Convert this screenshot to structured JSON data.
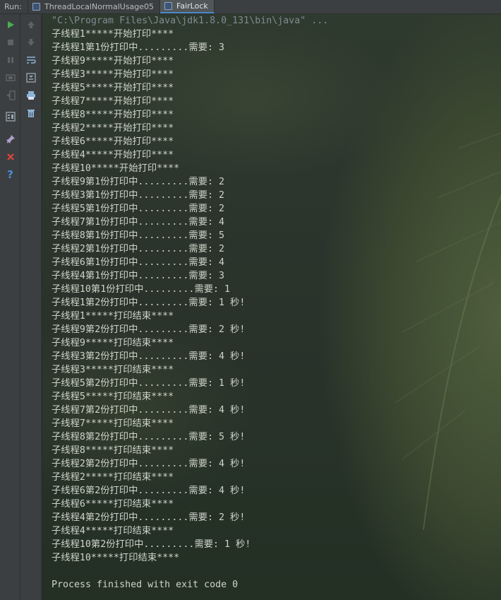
{
  "run_panel": {
    "run_label": "Run:",
    "tabs": [
      {
        "label": "ThreadLocalNormalUsage05",
        "active": false
      },
      {
        "label": "FairLock",
        "active": true
      }
    ]
  },
  "toolbar": {
    "left_icons": [
      "run-icon",
      "stop-icon",
      "pause-icon",
      "rerun-icon",
      "exit-icon",
      "layout-icon",
      "pin-icon",
      "close-icon",
      "help-icon"
    ],
    "right_icons": [
      "up-arrow-icon",
      "down-arrow-icon",
      "soft-wrap-icon",
      "scroll-to-end-icon",
      "print-icon",
      "trash-icon"
    ]
  },
  "console": {
    "command_line": "\"C:\\Program Files\\Java\\jdk1.8.0_131\\bin\\java\" ...",
    "lines": [
      "子线程1*****开始打印****",
      "子线程1第1份打印中.........需要: 3",
      "子线程9*****开始打印****",
      "子线程3*****开始打印****",
      "子线程5*****开始打印****",
      "子线程7*****开始打印****",
      "子线程8*****开始打印****",
      "子线程2*****开始打印****",
      "子线程6*****开始打印****",
      "子线程4*****开始打印****",
      "子线程10*****开始打印****",
      "子线程9第1份打印中.........需要: 2",
      "子线程3第1份打印中.........需要: 2",
      "子线程5第1份打印中.........需要: 2",
      "子线程7第1份打印中.........需要: 4",
      "子线程8第1份打印中.........需要: 5",
      "子线程2第1份打印中.........需要: 2",
      "子线程6第1份打印中.........需要: 4",
      "子线程4第1份打印中.........需要: 3",
      "子线程10第1份打印中.........需要: 1",
      "子线程1第2份打印中.........需要: 1 秒!",
      "子线程1*****打印结束****",
      "子线程9第2份打印中.........需要: 2 秒!",
      "子线程9*****打印结束****",
      "子线程3第2份打印中.........需要: 4 秒!",
      "子线程3*****打印结束****",
      "子线程5第2份打印中.........需要: 1 秒!",
      "子线程5*****打印结束****",
      "子线程7第2份打印中.........需要: 4 秒!",
      "子线程7*****打印结束****",
      "子线程8第2份打印中.........需要: 5 秒!",
      "子线程8*****打印结束****",
      "子线程2第2份打印中.........需要: 4 秒!",
      "子线程2*****打印结束****",
      "子线程6第2份打印中.........需要: 4 秒!",
      "子线程6*****打印结束****",
      "子线程4第2份打印中.........需要: 2 秒!",
      "子线程4*****打印结束****",
      "子线程10第2份打印中.........需要: 1 秒!",
      "子线程10*****打印结束****",
      "",
      "Process finished with exit code 0"
    ]
  },
  "colors": {
    "run_green": "#4caf50",
    "close_red": "#e0433c",
    "help_blue": "#4a90d9",
    "tab_active_underline": "#4a88c7",
    "console_text": "#cfd4c9"
  }
}
